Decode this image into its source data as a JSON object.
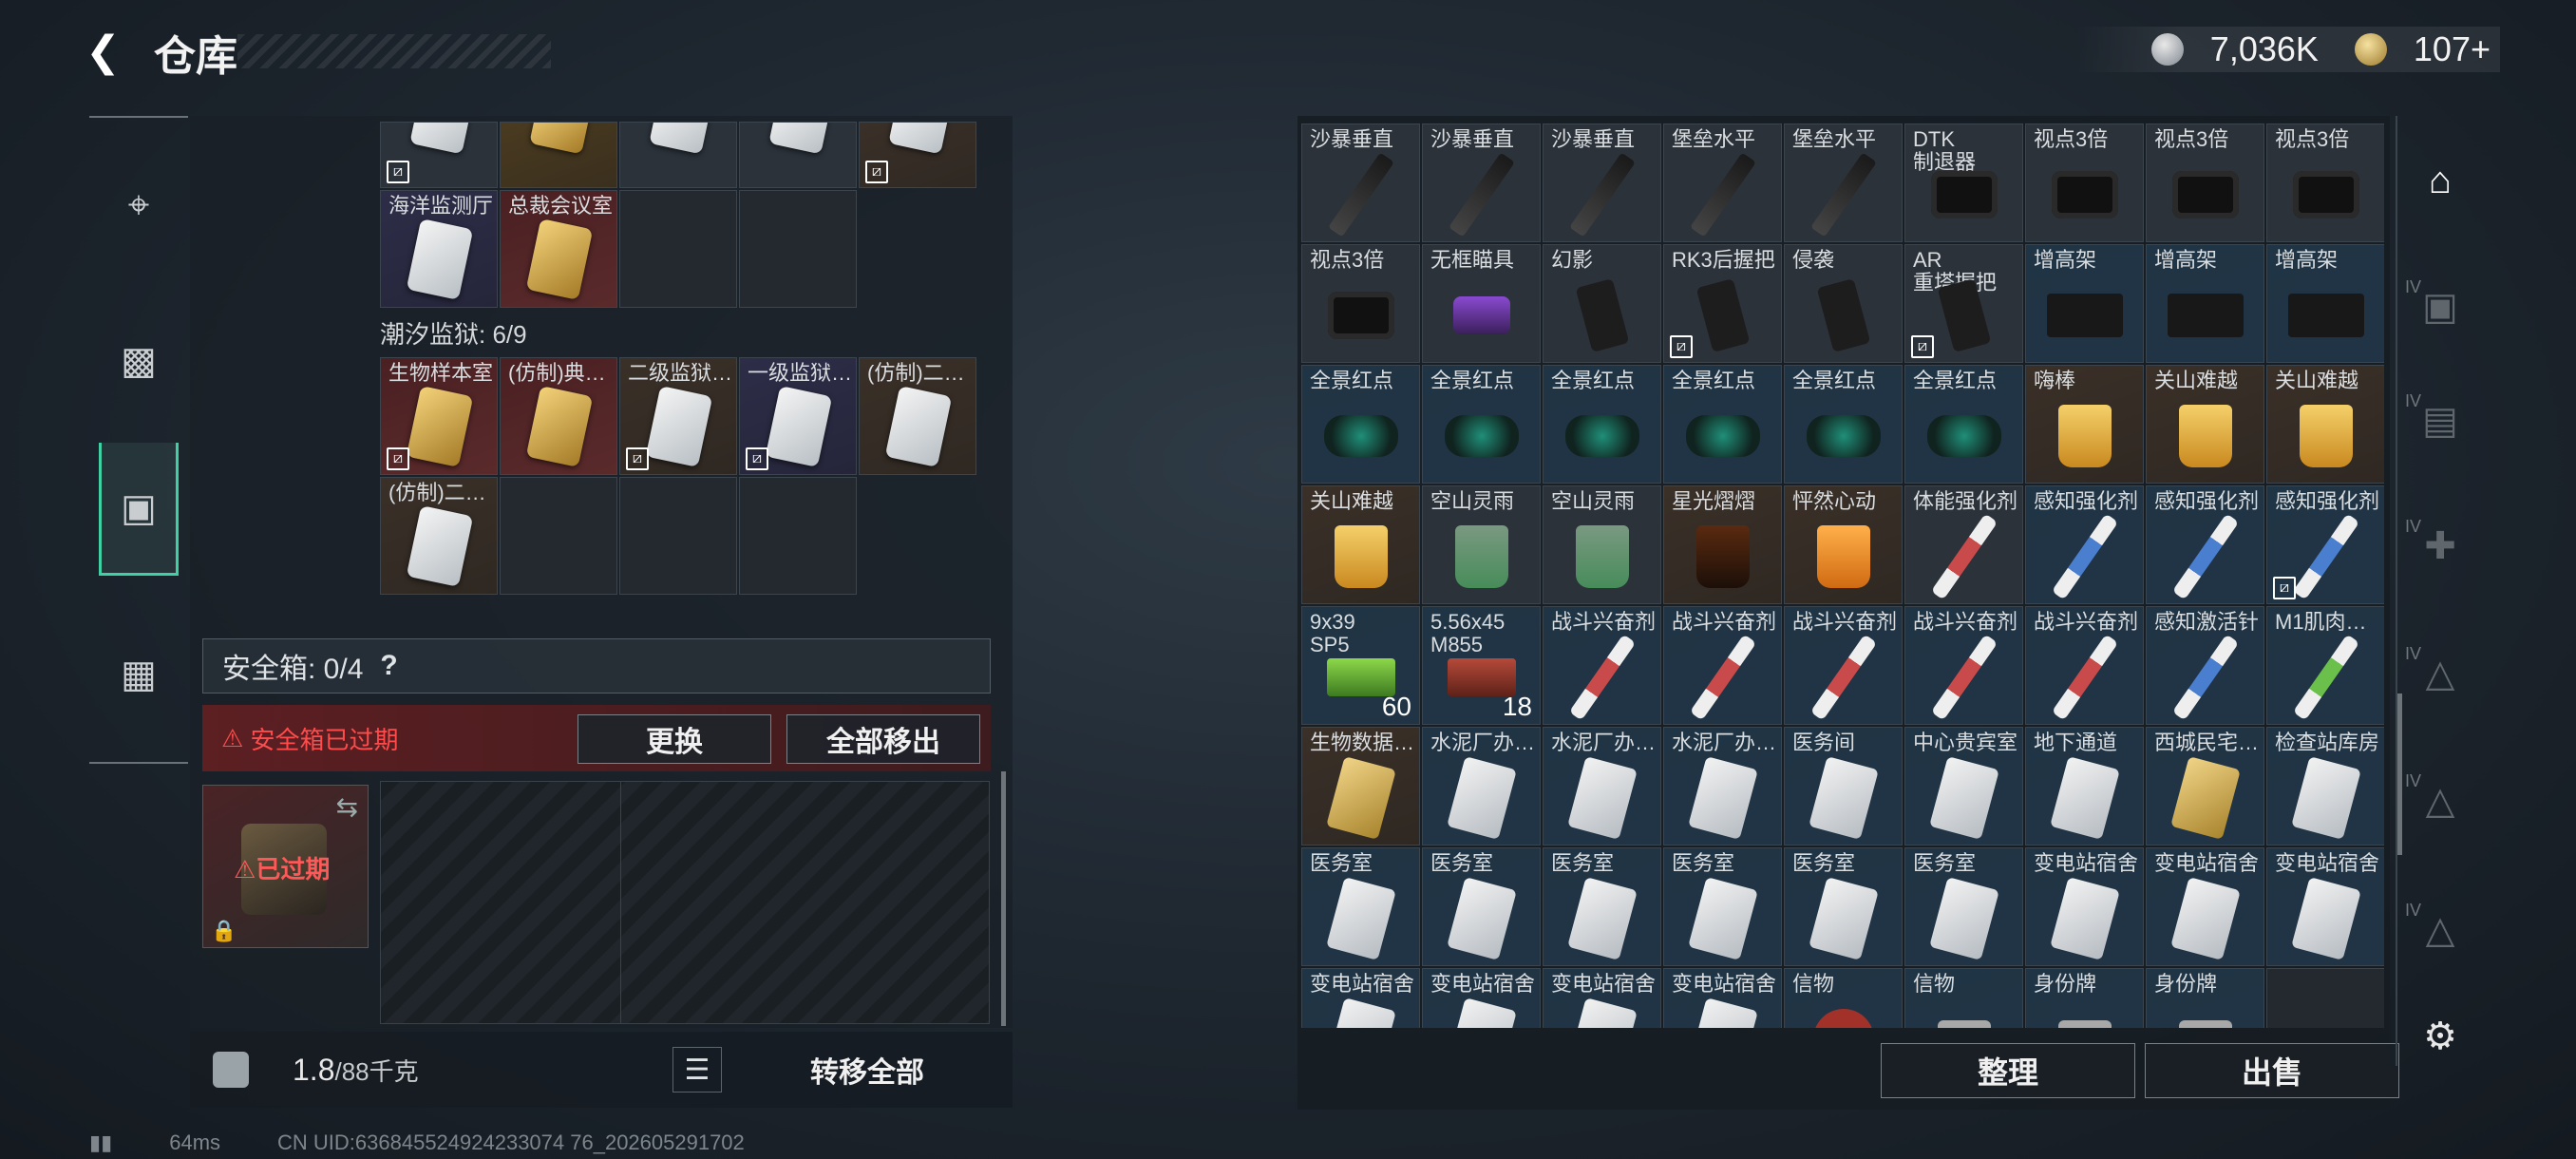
{
  "header": {
    "title": "仓库",
    "back_icon": "back-arrow-icon"
  },
  "currency": {
    "silver": "7,036K",
    "gold": "107+"
  },
  "left_sidebar": {
    "tabs": [
      {
        "icon": "gun-icon"
      },
      {
        "icon": "backpack-icon"
      },
      {
        "icon": "container-icon",
        "active": true
      },
      {
        "icon": "briefcase-icon"
      }
    ]
  },
  "left_grid_top": [
    {
      "label": "",
      "color": "grey",
      "nobind": true
    },
    {
      "label": "",
      "color": "gold",
      "nobind": false
    },
    {
      "label": "",
      "color": "grey",
      "nobind": false
    },
    {
      "label": "",
      "color": "grey",
      "nobind": false
    },
    {
      "label": "",
      "color": "brown",
      "nobind": true
    }
  ],
  "left_grid_row2": [
    {
      "label": "海洋监测厅",
      "color": "purple",
      "card": "white"
    },
    {
      "label": "总裁会议室",
      "color": "red",
      "card": "gold"
    }
  ],
  "section_title": "潮汐监狱: 6/9",
  "prison_keys": [
    {
      "label": "生物样本室",
      "color": "red",
      "card": "gold",
      "nobind": true
    },
    {
      "label": "(仿制)典…",
      "color": "red",
      "card": "gold",
      "nobind": false
    },
    {
      "label": "二级监狱…",
      "color": "brown",
      "card": "white",
      "nobind": true
    },
    {
      "label": "一级监狱…",
      "color": "purple",
      "card": "white",
      "nobind": true
    },
    {
      "label": "(仿制)二…",
      "color": "brown",
      "card": "white",
      "nobind": false
    },
    {
      "label": "(仿制)二…",
      "color": "brown",
      "card": "white",
      "nobind": false
    }
  ],
  "safe": {
    "label": "安全箱: 0/4",
    "help": "?",
    "expired_msg": "安全箱已过期",
    "replace_btn": "更换",
    "move_all_btn": "全部移出",
    "box_status": "已过期"
  },
  "weight": {
    "current": "1.8",
    "max": "/88千克"
  },
  "transfer_all_btn": "转移全部",
  "right_grid": [
    {
      "label": "沙暴垂直",
      "icon": "tube",
      "color": "grey"
    },
    {
      "label": "沙暴垂直",
      "icon": "tube",
      "color": "grey"
    },
    {
      "label": "沙暴垂直",
      "icon": "tube",
      "color": "grey"
    },
    {
      "label": "堡垒水平",
      "icon": "tube",
      "color": "grey"
    },
    {
      "label": "堡垒水平",
      "icon": "tube",
      "color": "grey"
    },
    {
      "label": "DTK\n制退器",
      "icon": "scope",
      "color": "grey"
    },
    {
      "label": "视点3倍",
      "icon": "scope",
      "color": "grey"
    },
    {
      "label": "视点3倍",
      "icon": "scope",
      "color": "grey"
    },
    {
      "label": "视点3倍",
      "icon": "scope",
      "color": "grey"
    },
    {
      "label": "视点3倍",
      "icon": "scope",
      "color": "grey"
    },
    {
      "label": "无框瞄具",
      "icon": "pur",
      "color": "grey"
    },
    {
      "label": "幻影",
      "icon": "grip",
      "color": "grey"
    },
    {
      "label": "RK3后握把",
      "icon": "grip",
      "color": "grey",
      "nobind": true
    },
    {
      "label": "侵袭",
      "icon": "grip",
      "color": "grey"
    },
    {
      "label": "AR\n重塔握把",
      "icon": "grip",
      "color": "grey",
      "nobind": true
    },
    {
      "label": "增高架",
      "icon": "mount",
      "color": "blue"
    },
    {
      "label": "增高架",
      "icon": "mount",
      "color": "blue"
    },
    {
      "label": "增高架",
      "icon": "mount",
      "color": "blue"
    },
    {
      "label": "全景红点",
      "icon": "dot",
      "color": "blue"
    },
    {
      "label": "全景红点",
      "icon": "dot",
      "color": "blue"
    },
    {
      "label": "全景红点",
      "icon": "dot",
      "color": "blue"
    },
    {
      "label": "全景红点",
      "icon": "dot",
      "color": "blue"
    },
    {
      "label": "全景红点",
      "icon": "dot",
      "color": "blue"
    },
    {
      "label": "全景红点",
      "icon": "dot",
      "color": "blue"
    },
    {
      "label": "嗨棒",
      "icon": "drink",
      "color": "brown"
    },
    {
      "label": "关山难越",
      "icon": "drink",
      "color": "brown"
    },
    {
      "label": "关山难越",
      "icon": "drink",
      "color": "brown"
    },
    {
      "label": "关山难越",
      "icon": "drink",
      "color": "brown"
    },
    {
      "label": "空山灵雨",
      "icon": "drink green",
      "color": "grey"
    },
    {
      "label": "空山灵雨",
      "icon": "drink green",
      "color": "grey"
    },
    {
      "label": "星光熠熠",
      "icon": "drink dark",
      "color": "brown"
    },
    {
      "label": "怦然心动",
      "icon": "drink orange",
      "color": "brown"
    },
    {
      "label": "体能强化剂",
      "icon": "syr",
      "color": "grey"
    },
    {
      "label": "感知强化剂",
      "icon": "syr blue",
      "color": "blue"
    },
    {
      "label": "感知强化剂",
      "icon": "syr blue",
      "color": "blue"
    },
    {
      "label": "感知强化剂",
      "icon": "syr blue",
      "color": "blue",
      "nobind": true
    },
    {
      "label": "9x39\nSP5",
      "icon": "ammo",
      "color": "blue",
      "count": "60"
    },
    {
      "label": "5.56x45\nM855",
      "icon": "ammo r",
      "color": "blue",
      "count": "18"
    },
    {
      "label": "战斗兴奋剂",
      "icon": "syr",
      "color": "blue"
    },
    {
      "label": "战斗兴奋剂",
      "icon": "syr",
      "color": "blue"
    },
    {
      "label": "战斗兴奋剂",
      "icon": "syr",
      "color": "blue"
    },
    {
      "label": "战斗兴奋剂",
      "icon": "syr",
      "color": "blue"
    },
    {
      "label": "战斗兴奋剂",
      "icon": "syr",
      "color": "blue"
    },
    {
      "label": "感知激活针",
      "icon": "syr blue",
      "color": "blue"
    },
    {
      "label": "M1肌肉…",
      "icon": "syr green",
      "color": "blue"
    },
    {
      "label": "生物数据…",
      "icon": "kc g",
      "color": "brown"
    },
    {
      "label": "水泥厂办…",
      "icon": "kc",
      "color": "blue"
    },
    {
      "label": "水泥厂办…",
      "icon": "kc",
      "color": "blue"
    },
    {
      "label": "水泥厂办…",
      "icon": "kc",
      "color": "blue"
    },
    {
      "label": "医务间",
      "icon": "kc",
      "color": "blue"
    },
    {
      "label": "中心贵宾室",
      "icon": "kc",
      "color": "blue"
    },
    {
      "label": "地下通道",
      "icon": "kc",
      "color": "blue"
    },
    {
      "label": "西城民宅…",
      "icon": "kc g",
      "color": "blue"
    },
    {
      "label": "检查站库房",
      "icon": "kc",
      "color": "blue"
    },
    {
      "label": "医务室",
      "icon": "kc",
      "color": "blue"
    },
    {
      "label": "医务室",
      "icon": "kc",
      "color": "blue"
    },
    {
      "label": "医务室",
      "icon": "kc",
      "color": "blue"
    },
    {
      "label": "医务室",
      "icon": "kc",
      "color": "blue"
    },
    {
      "label": "医务室",
      "icon": "kc",
      "color": "blue"
    },
    {
      "label": "医务室",
      "icon": "kc",
      "color": "blue"
    },
    {
      "label": "变电站宿舍",
      "icon": "kc",
      "color": "blue"
    },
    {
      "label": "变电站宿舍",
      "icon": "kc",
      "color": "blue"
    },
    {
      "label": "变电站宿舍",
      "icon": "kc",
      "color": "blue"
    },
    {
      "label": "变电站宿舍",
      "icon": "kc",
      "color": "blue"
    },
    {
      "label": "变电站宿舍",
      "icon": "kc",
      "color": "blue"
    },
    {
      "label": "变电站宿舍",
      "icon": "kc",
      "color": "blue"
    },
    {
      "label": "变电站宿舍",
      "icon": "kc",
      "color": "blue"
    },
    {
      "label": "信物",
      "icon": "head",
      "color": "blue"
    },
    {
      "label": "信物",
      "icon": "tag",
      "color": "blue"
    },
    {
      "label": "身份牌",
      "icon": "tag",
      "color": "blue"
    },
    {
      "label": "身份牌",
      "icon": "tag",
      "color": "blue"
    },
    {
      "label": "",
      "icon": "",
      "color": "empty"
    }
  ],
  "right_buttons": {
    "sort": "整理",
    "sell": "出售"
  },
  "right_sidebar": [
    {
      "icon": "warehouse-icon",
      "active": true
    },
    {
      "icon": "camera-storage-icon",
      "badge": "IV"
    },
    {
      "icon": "folder-storage-icon",
      "badge": "IV"
    },
    {
      "icon": "medkit-storage-icon",
      "badge": "IV"
    },
    {
      "icon": "warning-storage-icon",
      "badge": "IV"
    },
    {
      "icon": "warning-storage-icon",
      "badge": "IV"
    },
    {
      "icon": "warning-storage-icon",
      "badge": "IV"
    },
    {
      "icon": "settings-gear-icon"
    }
  ],
  "status": {
    "ping": "64ms",
    "uid": "CN UID:636845524924233074 76_202605291702"
  }
}
